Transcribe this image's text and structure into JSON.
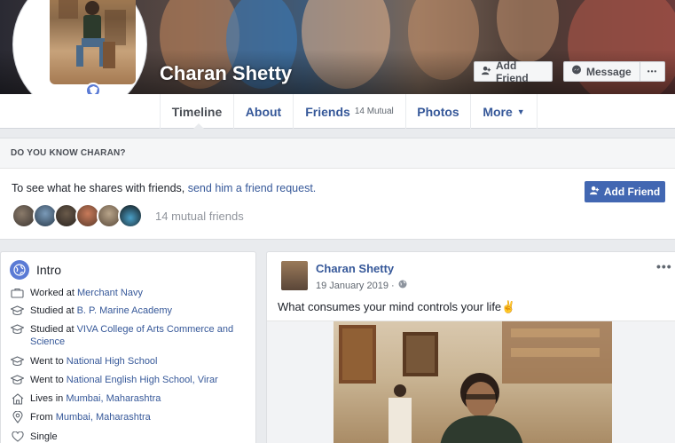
{
  "profile": {
    "name": "Charan Shetty",
    "add_friend": "Add Friend",
    "message": "Message",
    "more_dots": "•••"
  },
  "tabs": [
    {
      "label": "Timeline"
    },
    {
      "label": "About"
    },
    {
      "label": "Friends",
      "sub": "14 Mutual"
    },
    {
      "label": "Photos"
    },
    {
      "label": "More"
    }
  ],
  "know": {
    "heading": "DO YOU KNOW CHARAN?",
    "text_before": "To see what he shares with friends,",
    "link": "send him a friend request.",
    "button": "Add Friend",
    "mutual": "14 mutual friends"
  },
  "intro": {
    "title": "Intro",
    "items": [
      {
        "icon": "briefcase-icon",
        "prefix": "Worked at ",
        "link": "Merchant Navy",
        "suffix": ""
      },
      {
        "icon": "graduation-cap-icon",
        "prefix": "Studied at ",
        "link": "B. P. Marine Academy",
        "suffix": ""
      },
      {
        "icon": "graduation-cap-icon",
        "prefix": "Studied at ",
        "link": "VIVA College of Arts Commerce and Science",
        "suffix": ""
      },
      {
        "icon": "graduation-cap-icon",
        "prefix": "Went to ",
        "link": "National High School",
        "suffix": ""
      },
      {
        "icon": "graduation-cap-icon",
        "prefix": "Went to ",
        "link": "National English High School, Virar",
        "suffix": ""
      },
      {
        "icon": "home-icon",
        "prefix": "Lives in ",
        "link": "Mumbai, Maharashtra",
        "suffix": ""
      },
      {
        "icon": "location-pin-icon",
        "prefix": "From ",
        "link": "Mumbai, Maharashtra",
        "suffix": ""
      },
      {
        "icon": "heart-icon",
        "prefix": "Single",
        "link": "",
        "suffix": ""
      }
    ]
  },
  "post": {
    "author": "Charan Shetty",
    "date": "19 January 2019 ·",
    "text": "What consumes your mind controls your life✌",
    "more_dots": "•••"
  },
  "colors": {
    "brand_blue": "#4267b2",
    "link_blue": "#365899",
    "page_bg": "#e9ebee"
  }
}
